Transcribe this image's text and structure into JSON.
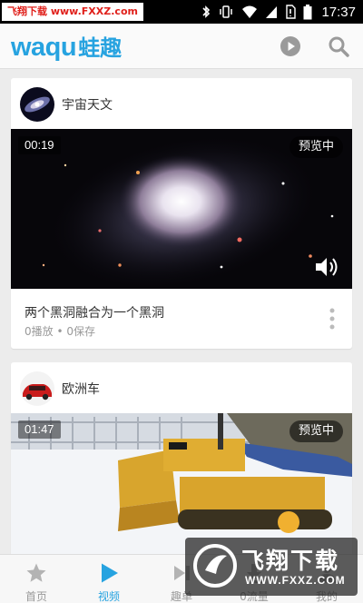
{
  "status_bar": {
    "watermark": "飞翔下载 www.FXXZ.com",
    "time": "17:37",
    "icons": [
      "bluetooth-icon",
      "vibrate-icon",
      "wifi-icon",
      "signal-icon",
      "no-sim-icon",
      "battery-icon"
    ]
  },
  "header": {
    "logo_latin": "waqu",
    "logo_cjk": "蛙趣",
    "brand_color": "#27a3e0",
    "play_button_icon": "play-circle-icon",
    "search_button_icon": "search-icon"
  },
  "feed": [
    {
      "channel": "宇宙天文",
      "duration": "00:19",
      "preview_label": "预览中",
      "title": "两个黑洞融合为一个黑洞",
      "meta": "0播放 • 0保存"
    },
    {
      "channel": "欧洲车",
      "duration": "01:47",
      "preview_label": "预览中"
    }
  ],
  "bottom_nav": {
    "items": [
      {
        "label": "首页",
        "icon": "star-icon",
        "active": false
      },
      {
        "label": "视频",
        "icon": "play-icon",
        "active": true
      },
      {
        "label": "趣单",
        "icon": "playlist-icon",
        "active": false
      },
      {
        "label": "0流量",
        "icon": "download-icon",
        "active": false
      },
      {
        "label": "我的",
        "icon": "user-icon",
        "active": false
      }
    ]
  },
  "watermark_bottom": {
    "main": "飞翔下载",
    "url": "WWW.FXXZ.COM"
  }
}
